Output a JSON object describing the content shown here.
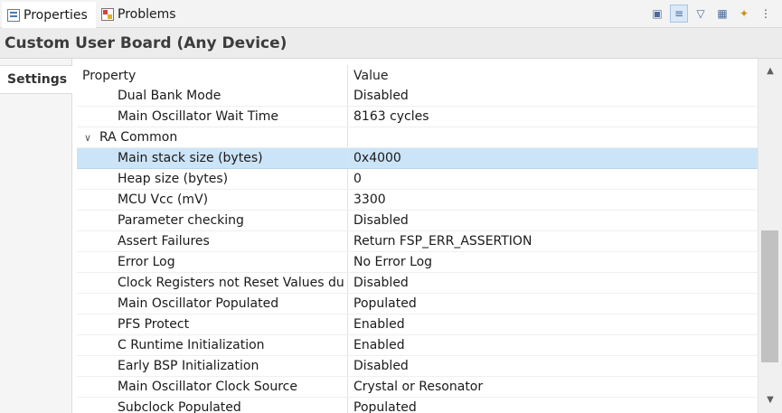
{
  "tabs": {
    "properties": "Properties",
    "problems": "Problems"
  },
  "toolbar": {
    "icons": [
      "pin-icon",
      "categories-icon",
      "filter-icon",
      "advanced-icon",
      "restore-defaults-icon",
      "view-menu-icon"
    ]
  },
  "title": "Custom User Board (Any Device)",
  "side_tabs": [
    "Settings"
  ],
  "table": {
    "headers": {
      "property": "Property",
      "value": "Value"
    },
    "rows": [
      {
        "property": "Dual Bank Mode",
        "value": "Disabled"
      },
      {
        "property": "Main Oscillator Wait Time",
        "value": "8163 cycles"
      },
      {
        "property": "RA Common",
        "value": ""
      },
      {
        "property": "Main stack size (bytes)",
        "value": "0x4000"
      },
      {
        "property": "Heap size (bytes)",
        "value": "0"
      },
      {
        "property": "MCU Vcc (mV)",
        "value": "3300"
      },
      {
        "property": "Parameter checking",
        "value": "Disabled"
      },
      {
        "property": "Assert Failures",
        "value": "Return FSP_ERR_ASSERTION"
      },
      {
        "property": "Error Log",
        "value": "No Error Log"
      },
      {
        "property": "Clock Registers not Reset Values du",
        "value": "Disabled"
      },
      {
        "property": "Main Oscillator Populated",
        "value": "Populated"
      },
      {
        "property": "PFS Protect",
        "value": "Enabled"
      },
      {
        "property": "C Runtime Initialization",
        "value": "Enabled"
      },
      {
        "property": "Early BSP Initialization",
        "value": "Disabled"
      },
      {
        "property": "Main Oscillator Clock Source",
        "value": "Crystal or Resonator"
      },
      {
        "property": "Subclock Populated",
        "value": "Populated"
      }
    ]
  },
  "colors": {
    "selected_row": "#cce4f7",
    "title_bg": "#ececec"
  }
}
